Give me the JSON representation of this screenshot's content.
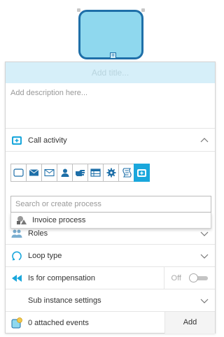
{
  "panel": {
    "title_placeholder": "Add title...",
    "description_placeholder": "Add description here..."
  },
  "call_activity": {
    "label": "Call activity",
    "task_types": [
      "none-task-icon",
      "send-task-icon",
      "receive-task-icon",
      "user-task-icon",
      "manual-task-icon",
      "business-rule-task-icon",
      "service-task-icon",
      "script-task-icon",
      "call-activity-icon"
    ]
  },
  "process_search": {
    "placeholder": "Search or create process",
    "options": [
      "Invoice process"
    ]
  },
  "roles": {
    "label": "Roles"
  },
  "loop_type": {
    "label": "Loop type"
  },
  "compensation": {
    "label": "Is for compensation",
    "state": "Off"
  },
  "sub_instance": {
    "label": "Sub instance settings"
  },
  "events": {
    "label": "0 attached events",
    "add_label": "Add"
  },
  "colors": {
    "accent": "#1aa7dc",
    "shape_fill": "#8fd8ee",
    "shape_border": "#1e6fa8",
    "title_bg": "#d6eff9"
  }
}
